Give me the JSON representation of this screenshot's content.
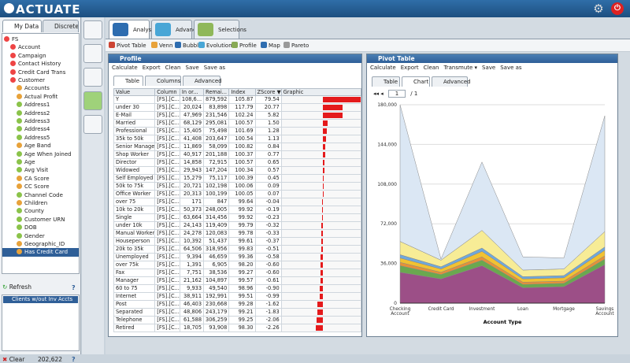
{
  "app": {
    "brand": "ACTUATE"
  },
  "left": {
    "tab_mydata": "My Data",
    "tab_discrete": "Discrete",
    "tree": [
      "FS",
      "Account",
      "Campaign",
      "Contact History",
      "Credit Card Trans",
      "Customer",
      "Accounts",
      "Actual Profit",
      "Address1",
      "Address2",
      "Address3",
      "Address4",
      "Address5",
      "Age Band",
      "Age When Joined",
      "Age",
      "Avg Visit",
      "CA Score",
      "CC Score",
      "Channel Code",
      "Children",
      "County",
      "Customer URN",
      "DOB",
      "Gender",
      "Geographic_ID",
      "Has Credit Card"
    ],
    "refresh": "Refresh",
    "saved": "Clients w/out Inv Accts",
    "clear": "Clear",
    "count": "202,622",
    "help": "?"
  },
  "tabs": {
    "analysis": "Analysis",
    "advanced": "Advanced",
    "selections": "Selections"
  },
  "toolbar": [
    "Pivot Table",
    "Venn",
    "Bubble",
    "Evolution",
    "Profile",
    "Map",
    "Pareto"
  ],
  "profile": {
    "title": "Profile",
    "menu": [
      "Calculate",
      "Export",
      "Clean",
      "Save",
      "Save as"
    ],
    "subtabs": [
      "Table",
      "Columns",
      "Advanced"
    ],
    "headers": [
      "Value",
      "Column",
      "In or...",
      "Remai...",
      "Index",
      "ZScore ▼",
      "Graphic"
    ],
    "rows": [
      [
        "Y",
        "[FS].[C...",
        "108,6...",
        "879,592",
        "105.87",
        "79.54",
        100,
        1
      ],
      [
        "under 30",
        "[FS].[C...",
        "20,024",
        "83,898",
        "117.79",
        "20.77",
        52,
        1
      ],
      [
        "E-Mail",
        "[FS].[C...",
        "47,969",
        "231,546",
        "102.24",
        "5.82",
        52,
        1
      ],
      [
        "Married",
        "[FS].[C...",
        "68,129",
        "295,081",
        "100.57",
        "1.50",
        14,
        0
      ],
      [
        "Professional",
        "[FS].[C...",
        "15,405",
        "75,498",
        "101.69",
        "1.28",
        11,
        0
      ],
      [
        "35k to 50k",
        "[FS].[C...",
        "41,408",
        "203,647",
        "100.54",
        "1.13",
        9,
        0
      ],
      [
        "Senior Manage",
        "[FS].[C...",
        "11,869",
        "58,099",
        "100.82",
        "0.84",
        7,
        0
      ],
      [
        "Shop Worker",
        "[FS].[C...",
        "40,917",
        "201,188",
        "100.37",
        "0.77",
        6,
        0
      ],
      [
        "Director",
        "[FS].[C...",
        "14,858",
        "72,915",
        "100.57",
        "0.65",
        5,
        0
      ],
      [
        "Widowed",
        "[FS].[C...",
        "29,943",
        "147,204",
        "100.34",
        "0.57",
        4,
        0
      ],
      [
        "Self Employed",
        "[FS].[C...",
        "15,279",
        "75,117",
        "100.39",
        "0.45",
        3,
        0
      ],
      [
        "50k to 75k",
        "[FS].[C...",
        "20,721",
        "102,198",
        "100.06",
        "0.09",
        1,
        0
      ],
      [
        "Office Worker",
        "[FS].[C...",
        "20,313",
        "100,199",
        "100.05",
        "0.07",
        1,
        0
      ],
      [
        "over 75",
        "[FS].[C...",
        "171",
        "847",
        "99.64",
        "-0.04",
        -1,
        0
      ],
      [
        "10k to 20k",
        "[FS].[C...",
        "50,373",
        "248,005",
        "99.92",
        "-0.19",
        -2,
        0
      ],
      [
        "Single",
        "[FS].[C...",
        "63,664",
        "314,456",
        "99.92",
        "-0.23",
        -2,
        0
      ],
      [
        "under 10k",
        "[FS].[C...",
        "24,143",
        "119,409",
        "99.79",
        "-0.32",
        -3,
        0
      ],
      [
        "Manual Worker",
        "[FS].[C...",
        "24,278",
        "120,083",
        "99.78",
        "-0.33",
        -3,
        0
      ],
      [
        "Houseperson",
        "[FS].[C...",
        "10,392",
        "51,437",
        "99.61",
        "-0.37",
        -3,
        0
      ],
      [
        "20k to 35k",
        "[FS].[C...",
        "64,506",
        "318,956",
        "99.83",
        "-0.51",
        -4,
        0
      ],
      [
        "Unemployed",
        "[FS].[C...",
        "9,394",
        "46,659",
        "99.36",
        "-0.58",
        -5,
        0
      ],
      [
        "over 75k",
        "[FS].[C...",
        "1,391",
        "6,905",
        "98.20",
        "-0.60",
        -5,
        0
      ],
      [
        "Fax",
        "[FS].[C...",
        "7,751",
        "38,536",
        "99.27",
        "-0.60",
        -5,
        0
      ],
      [
        "Manager",
        "[FS].[C...",
        "21,162",
        "104,897",
        "99.57",
        "-0.61",
        -5,
        0
      ],
      [
        "60 to 75",
        "[FS].[C...",
        "9,933",
        "49,540",
        "98.96",
        "-0.90",
        -7,
        0
      ],
      [
        "Internet",
        "[FS].[C...",
        "38,911",
        "192,991",
        "99.51",
        "-0.99",
        -8,
        0
      ],
      [
        "Post",
        "[FS].[C...",
        "46,403",
        "230,668",
        "99.28",
        "-1.62",
        -13,
        0
      ],
      [
        "Separated",
        "[FS].[C...",
        "48,806",
        "243,179",
        "99.21",
        "-1.83",
        -14,
        0
      ],
      [
        "Telephone",
        "[FS].[C...",
        "61,588",
        "306,259",
        "99.25",
        "-2.06",
        -16,
        1
      ],
      [
        "Retired",
        "[FS].[C...",
        "18,705",
        "93,908",
        "98.30",
        "-2.26",
        -17,
        1
      ]
    ]
  },
  "pivot": {
    "title": "Pivot Table",
    "menu": [
      "Calculate",
      "Export",
      "Clean",
      "Transmute ▾",
      "Save",
      "Save as"
    ],
    "subtabs": [
      "Table",
      "Chart",
      "Advanced"
    ],
    "page": "1",
    "page_of": "/ 1"
  },
  "chart_data": {
    "type": "area",
    "stacked": true,
    "categories": [
      "Checking Account",
      "Credit Card",
      "Investment",
      "Loan",
      "Mortgage",
      "Savings Account"
    ],
    "xlabel": "Account Type",
    "ylabel": "",
    "yticks": [
      "0",
      "36,000",
      "72,000",
      "108,000",
      "144,000",
      "180,000"
    ],
    "ylim": [
      0,
      180000
    ],
    "series": [
      {
        "color": "#9c4f87",
        "values": [
          28000,
          22000,
          34000,
          14000,
          15000,
          35000
        ]
      },
      {
        "color": "#6aa84f",
        "values": [
          6000,
          4000,
          5000,
          3000,
          3000,
          5000
        ]
      },
      {
        "color": "#e69138",
        "values": [
          3000,
          2000,
          3000,
          2000,
          2000,
          3000
        ]
      },
      {
        "color": "#f1c232",
        "values": [
          4000,
          3000,
          5000,
          3000,
          3000,
          5000
        ]
      },
      {
        "color": "#6fa8dc",
        "values": [
          3000,
          2000,
          3000,
          2000,
          2000,
          3000
        ]
      },
      {
        "color": "#f7ec96",
        "values": [
          12000,
          6000,
          16000,
          6000,
          6000,
          14000
        ]
      },
      {
        "color": "#dbe7f4",
        "values": [
          124000,
          1000,
          62000,
          12000,
          10000,
          105000
        ]
      }
    ]
  }
}
